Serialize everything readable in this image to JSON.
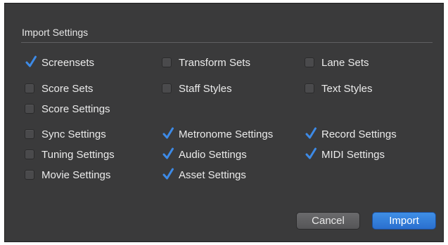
{
  "dialog": {
    "section_title": "Import Settings",
    "accent_color": "#3d8ae6",
    "checkboxes": [
      {
        "label": "Screensets",
        "checked": true
      },
      {
        "label": "Transform Sets",
        "checked": false
      },
      {
        "label": "Lane Sets",
        "checked": false
      },
      {
        "label": "Score Sets",
        "checked": false
      },
      {
        "label": "Staff Styles",
        "checked": false
      },
      {
        "label": "Text Styles",
        "checked": false
      },
      {
        "label": "Score Settings",
        "checked": false
      },
      {
        "label": "Sync Settings",
        "checked": false
      },
      {
        "label": "Metronome Settings",
        "checked": true
      },
      {
        "label": "Record Settings",
        "checked": true
      },
      {
        "label": "Tuning Settings",
        "checked": false
      },
      {
        "label": "Audio Settings",
        "checked": true
      },
      {
        "label": "MIDI Settings",
        "checked": true
      },
      {
        "label": "Movie Settings",
        "checked": false
      },
      {
        "label": "Asset Settings",
        "checked": true
      }
    ],
    "buttons": {
      "cancel_label": "Cancel",
      "import_label": "Import"
    }
  }
}
